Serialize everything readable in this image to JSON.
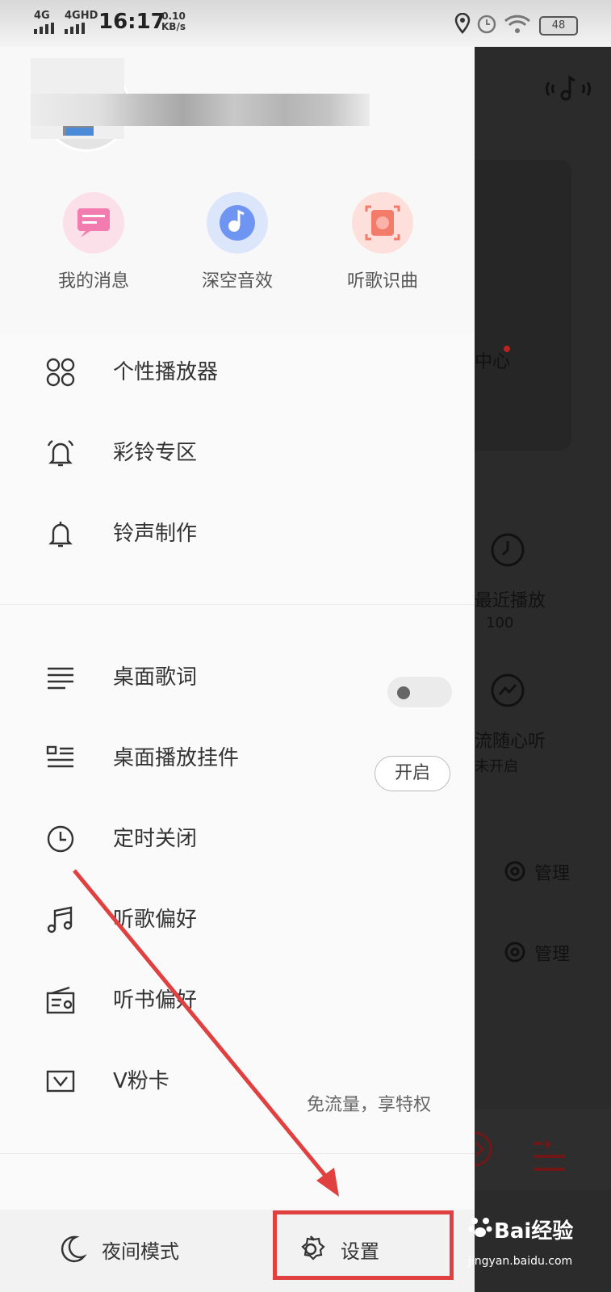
{
  "status_bar": {
    "signal1": "4G",
    "signal2": "4GHD",
    "time": "16:17",
    "speed_value": "0.10",
    "speed_unit": "KB/s",
    "battery": "48"
  },
  "quick_actions": [
    {
      "label": "我的消息",
      "icon": "message-icon",
      "color": "#f27bb0"
    },
    {
      "label": "深空音效",
      "icon": "sound-effect-icon",
      "color": "#6f95f2"
    },
    {
      "label": "听歌识曲",
      "icon": "recognize-song-icon",
      "color": "#f37b6a"
    }
  ],
  "menu_group1": [
    {
      "label": "个性播放器",
      "icon": "player-skin-icon"
    },
    {
      "label": "彩铃专区",
      "icon": "ringtone-zone-icon"
    },
    {
      "label": "铃声制作",
      "icon": "bell-icon"
    }
  ],
  "menu_group2": [
    {
      "label": "桌面歌词",
      "icon": "lyrics-icon",
      "control": "toggle",
      "toggle_on": false
    },
    {
      "label": "桌面播放挂件",
      "icon": "widget-icon",
      "control": "button",
      "button_label": "开启"
    },
    {
      "label": "定时关闭",
      "icon": "clock-icon"
    },
    {
      "label": "听歌偏好",
      "icon": "music-note-icon"
    },
    {
      "label": "听书偏好",
      "icon": "radio-icon"
    },
    {
      "label": "V粉卡",
      "icon": "vcard-icon",
      "subtitle": "免流量，享特权"
    }
  ],
  "bottom_bar": {
    "night_mode": "夜间模式",
    "settings": "设置"
  },
  "background_app": {
    "center_fragment": "中心",
    "recent_label": "最近播放",
    "recent_count": "100",
    "flow_label": "流随心听",
    "flow_status": "未开启",
    "manage1": "管理",
    "manage2": "管理"
  },
  "watermark": {
    "brand": "Bai经验",
    "url": "jingyan.baidu.com"
  },
  "colors": {
    "accent_red": "#e04040",
    "dim_overlay": "#2b2b2b"
  }
}
